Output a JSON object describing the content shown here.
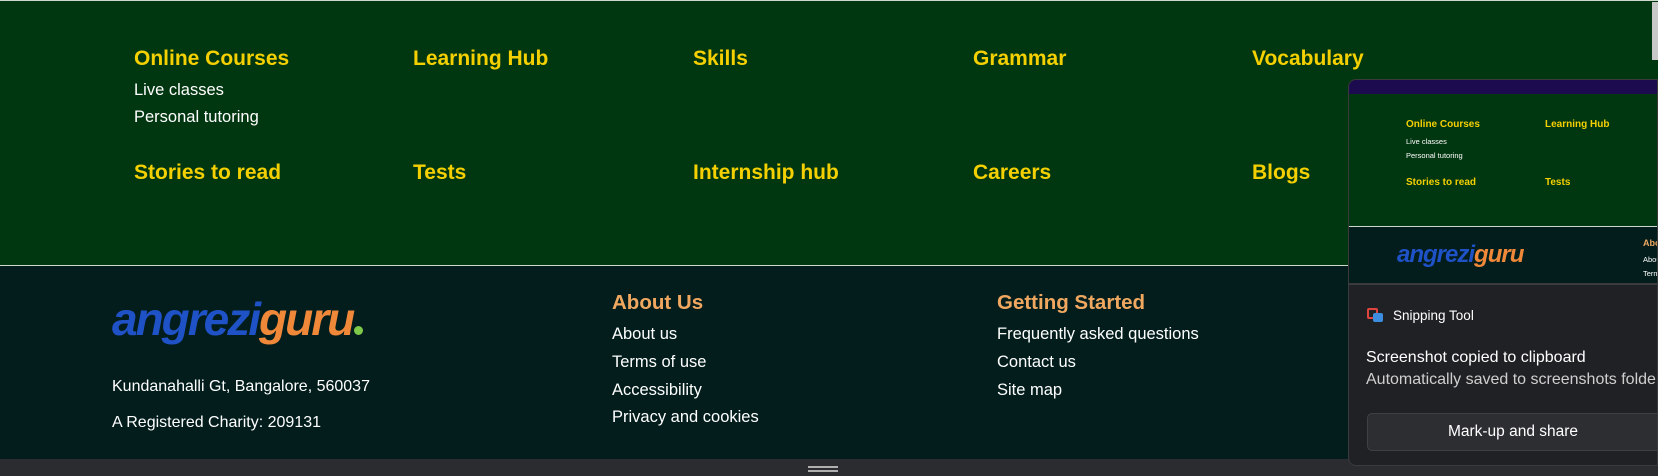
{
  "nav": {
    "row1": [
      {
        "title": "Online Courses",
        "subs": [
          "Live classes",
          "Personal tutoring"
        ]
      },
      {
        "title": "Learning Hub"
      },
      {
        "title": "Skills"
      },
      {
        "title": "Grammar"
      },
      {
        "title": "Vocabulary"
      }
    ],
    "row2": [
      "Stories to read",
      "Tests",
      "Internship hub",
      "Careers",
      "Blogs"
    ]
  },
  "footer": {
    "logo": {
      "part1": "angrezi",
      "part2": "guru"
    },
    "address": "Kundanahalli Gt, Bangalore, 560037",
    "charity": "A Registered Charity: 209131",
    "about": {
      "heading": "About Us",
      "links": [
        "About us",
        "Terms of use",
        "Accessibility",
        "Privacy and cookies"
      ]
    },
    "started": {
      "heading": "Getting Started",
      "links": [
        "Frequently asked questions",
        "Contact us",
        "Site map"
      ]
    }
  },
  "preview": {
    "h1": "Online Courses",
    "h2": "Learning Hub",
    "s1": "Live classes",
    "s2": "Personal tutoring",
    "h3": "Stories to read",
    "h4": "Tests",
    "fh": "Abo",
    "fl1": "Abou",
    "fl2": "Term",
    "logo1": "angrezi",
    "logo2": "guru"
  },
  "toast": {
    "app_name": "Snipping Tool",
    "title": "Screenshot copied to clipboard",
    "message": "Automatically saved to screenshots folder",
    "button": "Mark-up and share"
  },
  "colors": {
    "nav_bg": "#013710",
    "nav_heading": "#f5d000",
    "footer_bg": "#021d1c",
    "footer_heading": "#f0a860",
    "toast_bg": "#202124"
  }
}
